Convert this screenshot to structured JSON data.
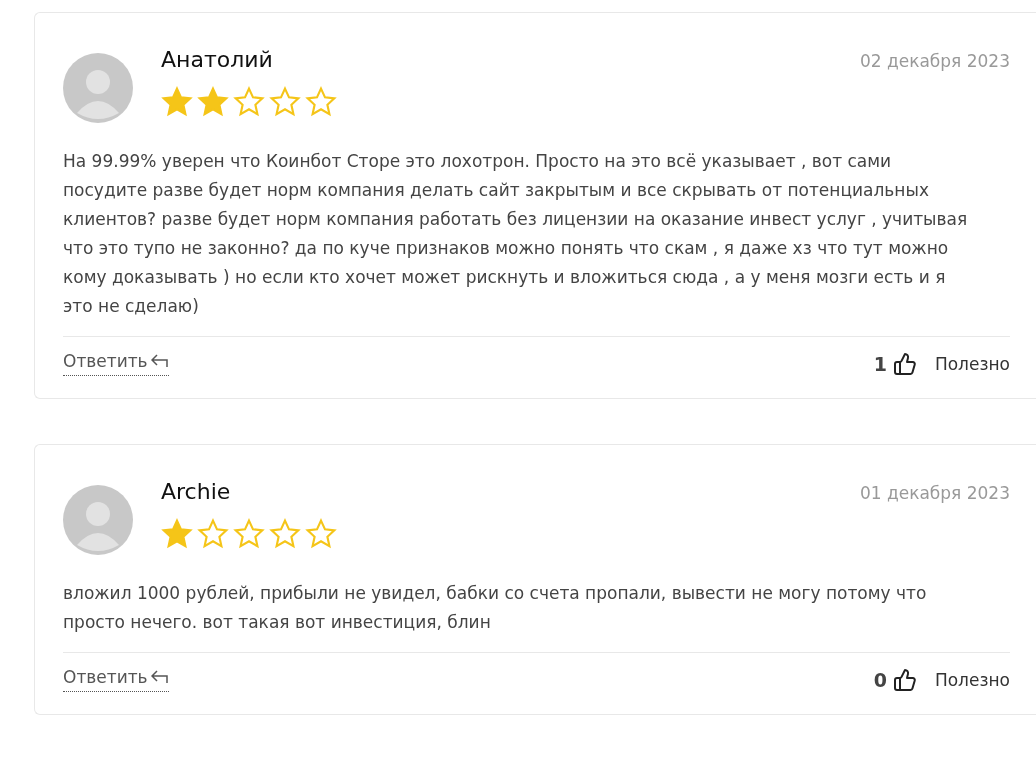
{
  "reviews": [
    {
      "author": "Анатолий",
      "date": "02 декабря 2023",
      "stars": 2,
      "text": "На 99.99% уверен что Коинбот Сторе это лохотрон. Просто на это всё указывает , вот сами посудите разве будет норм компания делать сайт закрытым и все скрывать от потенциальных клиентов? разве будет норм компания работать без лицензии на оказание инвест услуг , учитывая что это тупо не законно? да по куче признаков можно понять что скам , я даже хз что тут можно кому доказывать ) но если кто хочет может рискнуть и вложиться сюда , а у меня мозги есть и я это не сделаю)",
      "reply": "Ответить",
      "likes": "1",
      "helpful": "Полезно"
    },
    {
      "author": "Archie",
      "date": "01 декабря 2023",
      "stars": 1,
      "text": "вложил 1000 рублей, прибыли не увидел, бабки со счета пропали, вывести не могу потому что просто нечего. вот такая вот инвестиция, блин",
      "reply": "Ответить",
      "likes": "0",
      "helpful": "Полезно"
    }
  ]
}
